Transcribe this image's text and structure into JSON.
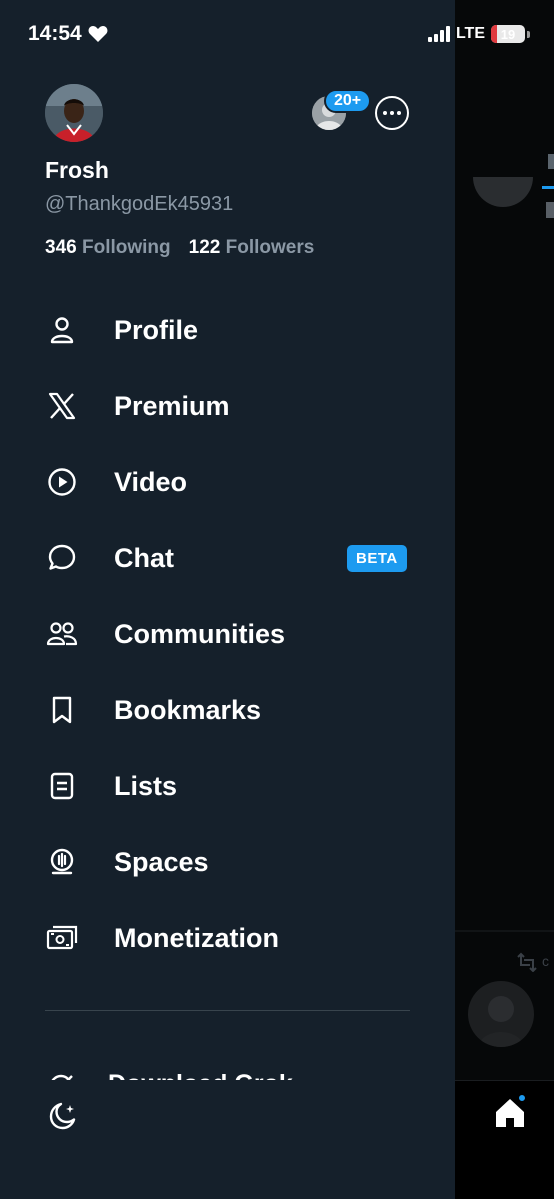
{
  "status_bar": {
    "time": "14:54",
    "network": "LTE",
    "battery_level": "19"
  },
  "profile": {
    "display_name": "Frosh",
    "handle": "@ThankgodEk45931",
    "following_count": "346",
    "following_label": "Following",
    "followers_count": "122",
    "followers_label": "Followers",
    "accounts_badge": "20+"
  },
  "menu": {
    "items": [
      {
        "label": "Profile",
        "icon": "person-icon"
      },
      {
        "label": "Premium",
        "icon": "x-logo-icon"
      },
      {
        "label": "Video",
        "icon": "play-circle-icon"
      },
      {
        "label": "Chat",
        "icon": "chat-bubble-icon",
        "badge": "BETA"
      },
      {
        "label": "Communities",
        "icon": "communities-icon"
      },
      {
        "label": "Bookmarks",
        "icon": "bookmark-icon"
      },
      {
        "label": "Lists",
        "icon": "list-icon"
      },
      {
        "label": "Spaces",
        "icon": "microphone-icon"
      },
      {
        "label": "Monetization",
        "icon": "money-icon"
      }
    ],
    "grok_label": "Download Grok"
  },
  "colors": {
    "drawer_bg": "#15202b",
    "accent": "#1d9bf0",
    "secondary_text": "#8b98a5",
    "battery_low": "#e0393e"
  }
}
